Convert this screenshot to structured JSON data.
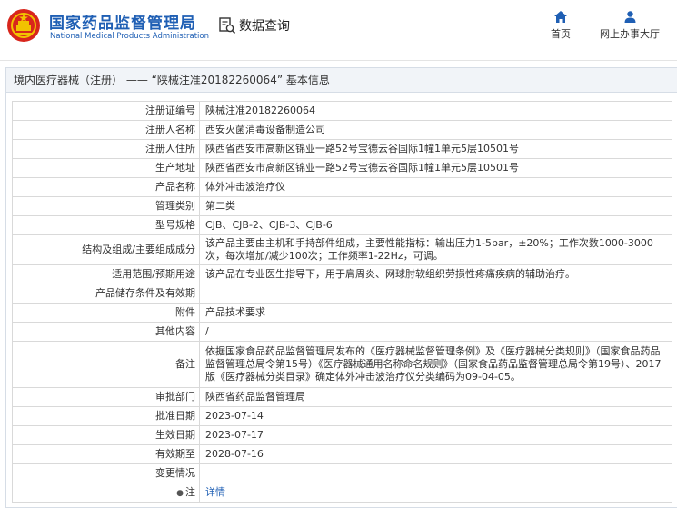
{
  "header": {
    "brand_cn": "国家药品监督管理局",
    "brand_en": "National Medical Products Administration",
    "search_label": "数据查询",
    "nav": {
      "home": "首页",
      "online": "网上办事大厅"
    },
    "colors": {
      "brand": "#1f5fb4",
      "logo_red": "#d8261c",
      "logo_gold": "#f2c200"
    }
  },
  "panel": {
    "title": "境内医疗器械（注册） —— “陕械注准20182260064” 基本信息"
  },
  "rows": [
    {
      "label": "注册证编号",
      "value": "陕械注准20182260064"
    },
    {
      "label": "注册人名称",
      "value": "西安灭菌消毒设备制造公司"
    },
    {
      "label": "注册人住所",
      "value": "陕西省西安市高新区锦业一路52号宝德云谷国际1幢1单元5层10501号"
    },
    {
      "label": "生产地址",
      "value": "陕西省西安市高新区锦业一路52号宝德云谷国际1幢1单元5层10501号"
    },
    {
      "label": "产品名称",
      "value": "体外冲击波治疗仪"
    },
    {
      "label": "管理类别",
      "value": "第二类"
    },
    {
      "label": "型号规格",
      "value": "CJB、CJB-2、CJB-3、CJB-6"
    },
    {
      "label": "结构及组成/主要组成成分",
      "value": "该产品主要由主机和手持部件组成，主要性能指标：输出压力1-5bar，±20%；工作次数1000-3000次，每次增加/减少100次；工作频率1-22Hz，可调。"
    },
    {
      "label": "适用范围/预期用途",
      "value": "该产品在专业医生指导下，用于肩周炎、网球肘软组织劳损性疼痛疾病的辅助治疗。"
    },
    {
      "label": "产品储存条件及有效期",
      "value": ""
    },
    {
      "label": "附件",
      "value": "产品技术要求"
    },
    {
      "label": "其他内容",
      "value": "/"
    },
    {
      "label": "备注",
      "value": "依据国家食品药品监督管理局发布的《医疗器械监督管理条例》及《医疗器械分类规则》（国家食品药品监督管理总局令第15号）《医疗器械通用名称命名规则》（国家食品药品监督管理总局令第19号）、2017版《医疗器械分类目录》确定体外冲击波治疗仪分类编码为09-04-05。"
    },
    {
      "label": "审批部门",
      "value": "陕西省药品监督管理局"
    },
    {
      "label": "批准日期",
      "value": "2023-07-14"
    },
    {
      "label": "生效日期",
      "value": "2023-07-17"
    },
    {
      "label": "有效期至",
      "value": "2028-07-16"
    },
    {
      "label": "变更情况",
      "value": ""
    },
    {
      "label": "注",
      "value": "详情"
    }
  ]
}
